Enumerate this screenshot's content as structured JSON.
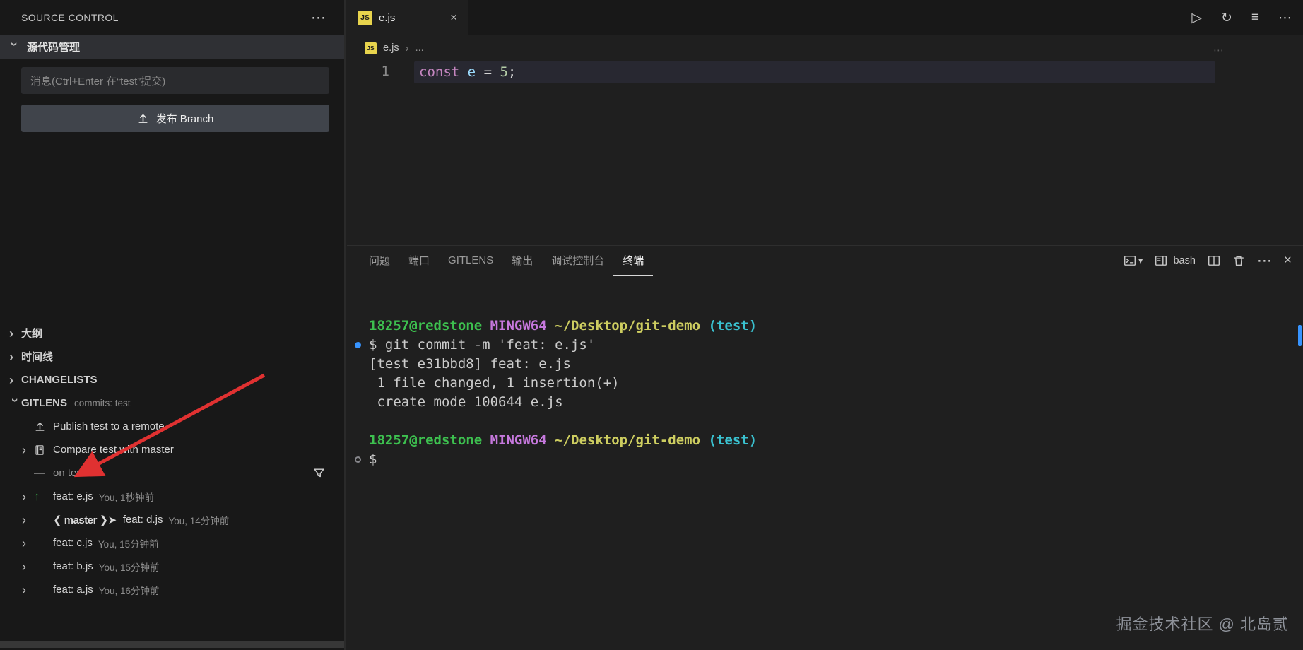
{
  "colors": {
    "accent_blue": "#3794ff",
    "arrow_red": "#e03131",
    "gitlens_green": "#3fb950",
    "ansi": {
      "green": "#3dc04f",
      "magenta": "#c678dd",
      "yellow": "#cdcd60",
      "cyan": "#3ac1cf",
      "fg": "#cccccc"
    },
    "code": {
      "keyword": "#c586c0",
      "variable": "#9cdcfe",
      "operator": "#d4d4d4",
      "number": "#b5cea8",
      "punctuation": "#d4d4d4",
      "plain": "#d4d4d4"
    }
  },
  "icons": {
    "more": "⋯",
    "chevron": "›",
    "dropdown": "▾",
    "run": "▷",
    "restart": "↻",
    "layout": "≡",
    "close": "×",
    "dash": "—",
    "arrow_up": "↑"
  },
  "sidebar": {
    "title": "SOURCE CONTROL",
    "scm_section": "源代码管理",
    "message_placeholder": "消息(Ctrl+Enter 在“test”提交)",
    "publish_button": "发布 Branch",
    "sections": [
      {
        "name": "outline",
        "label": "大纲",
        "chevron": "right"
      },
      {
        "name": "timeline",
        "label": "时间线",
        "chevron": "right"
      },
      {
        "name": "changelists",
        "label": "CHANGELISTS",
        "chevron": "right"
      },
      {
        "name": "gitlens",
        "label": "GITLENS",
        "chevron": "down",
        "description": "commits: test"
      }
    ],
    "gitlens_items": [
      {
        "name": "publish-test",
        "icon": "upload",
        "label": "Publish test to a remote"
      },
      {
        "name": "compare-test",
        "chevron": true,
        "icon": "compare",
        "label": "Compare test with master"
      },
      {
        "name": "on-test",
        "icon": "dash",
        "label": "on test",
        "muted": true,
        "filter_icon": true
      },
      {
        "name": "commit-feat-e",
        "chevron": true,
        "icon": "arrow-up",
        "label": "feat: e.js",
        "description": "You, 1秒钟前"
      },
      {
        "name": "commit-feat-d",
        "chevron": true,
        "prefix": "❮ master ❯➤",
        "label": "feat: d.js",
        "description": "You, 14分钟前"
      },
      {
        "name": "commit-feat-c",
        "chevron": true,
        "label": "feat: c.js",
        "description": "You, 15分钟前"
      },
      {
        "name": "commit-feat-b",
        "chevron": true,
        "label": "feat: b.js",
        "description": "You, 15分钟前"
      },
      {
        "name": "commit-feat-a",
        "chevron": true,
        "label": "feat: a.js",
        "description": "You, 16分钟前"
      }
    ]
  },
  "editor": {
    "tab_label": "e.js",
    "js_badge": "JS",
    "breadcrumb_file": "e.js",
    "breadcrumb_more": "...",
    "line_number": "1",
    "code_tokens": [
      {
        "text": "const",
        "type": "keyword"
      },
      {
        "text": " ",
        "type": "plain"
      },
      {
        "text": "e",
        "type": "variable"
      },
      {
        "text": " ",
        "type": "plain"
      },
      {
        "text": "=",
        "type": "operator"
      },
      {
        "text": " ",
        "type": "plain"
      },
      {
        "text": "5",
        "type": "number"
      },
      {
        "text": ";",
        "type": "punctuation"
      }
    ]
  },
  "panel": {
    "tabs": [
      {
        "name": "problems",
        "label": "问题"
      },
      {
        "name": "ports",
        "label": "端口"
      },
      {
        "name": "gitlens",
        "label": "GITLENS"
      },
      {
        "name": "output",
        "label": "输出"
      },
      {
        "name": "debug-console",
        "label": "调试控制台"
      },
      {
        "name": "terminal",
        "label": "终端",
        "active": true
      }
    ],
    "shell_label": "bash",
    "terminal_lines": [
      {
        "bold": true,
        "segments": [
          {
            "text": "18257@redstone",
            "color": "green"
          },
          {
            "text": " ",
            "color": "fg"
          },
          {
            "text": "MINGW64",
            "color": "magenta"
          },
          {
            "text": " ",
            "color": "fg"
          },
          {
            "text": "~/Desktop/git-demo",
            "color": "yellow"
          },
          {
            "text": " ",
            "color": "fg"
          },
          {
            "text": "(test)",
            "color": "cyan"
          }
        ]
      },
      {
        "marker": "filled",
        "segments": [
          {
            "text": "$ git commit -m 'feat: e.js'",
            "color": "fg"
          }
        ]
      },
      {
        "segments": [
          {
            "text": "[test e31bbd8] feat: e.js",
            "color": "fg"
          }
        ]
      },
      {
        "segments": [
          {
            "text": " 1 file changed, 1 insertion(+)",
            "color": "fg"
          }
        ]
      },
      {
        "segments": [
          {
            "text": " create mode 100644 e.js",
            "color": "fg"
          }
        ]
      },
      {
        "segments": []
      },
      {
        "bold": true,
        "segments": [
          {
            "text": "18257@redstone",
            "color": "green"
          },
          {
            "text": " ",
            "color": "fg"
          },
          {
            "text": "MINGW64",
            "color": "magenta"
          },
          {
            "text": " ",
            "color": "fg"
          },
          {
            "text": "~/Desktop/git-demo",
            "color": "yellow"
          },
          {
            "text": " ",
            "color": "fg"
          },
          {
            "text": "(test)",
            "color": "cyan"
          }
        ]
      },
      {
        "marker": "hollow",
        "segments": [
          {
            "text": "$",
            "color": "fg"
          }
        ]
      }
    ]
  },
  "watermark": "掘金技术社区 @ 北岛贰"
}
